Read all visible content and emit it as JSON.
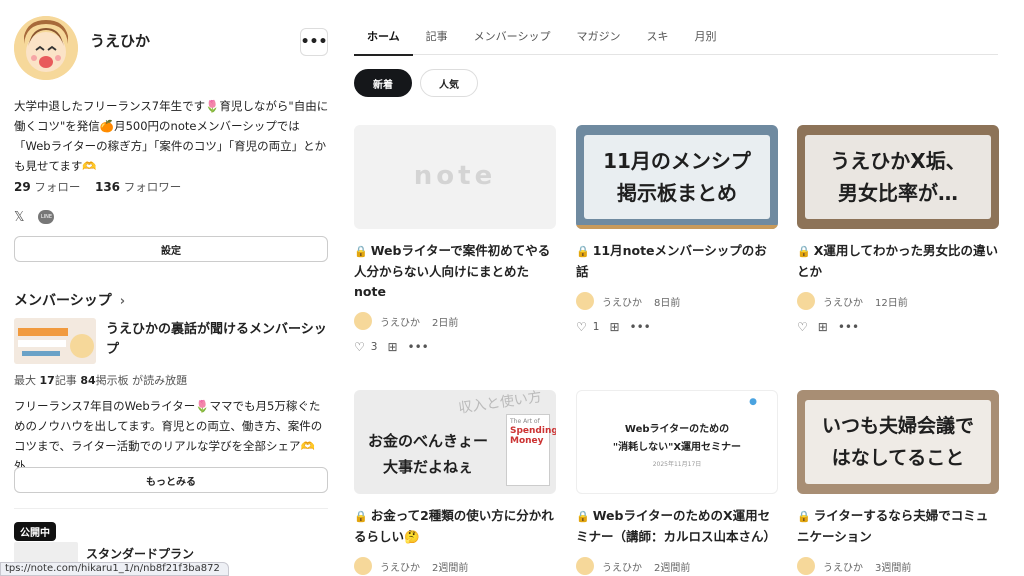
{
  "profile": {
    "name": "うえひか",
    "more_label": "•••",
    "bio": "大学中退したフリーランス7年生です🌷育児しながら\"自由に働くコツ\"を発信🍊月500円のnoteメンバーシップでは「Webライターの稼ぎ方」「案件のコツ」「育児の両立」とかも見せてます🫶",
    "following_count": "29",
    "following_label": "フォロー",
    "followers_count": "136",
    "followers_label": "フォロワー",
    "social": [
      "𝕏",
      "LINE"
    ],
    "settings_label": "設定"
  },
  "membership": {
    "section_title": "メンバーシップ",
    "chevron": "›",
    "name": "うえひかの裏話が聞けるメンバーシップ",
    "meta_prefix": "最大",
    "articles": "17",
    "articles_label": "記事",
    "boards": "84",
    "boards_label": "掲示板 が読み放題",
    "description": "フリーランス7年目のWebライター🌷ママでも月5万稼ぐためのノウハウを出してます。育児との両立、働き方、案件のコツまで、ライター活動でのリアルな学びを全部シェア🫶外...",
    "more_label": "もっとみる",
    "public_badge": "公開中",
    "plan_name": "スタンダードプラン"
  },
  "status_url": "tps://note.com/hikaru1_1/n/nb8f21f3ba872",
  "tabs": [
    "ホーム",
    "記事",
    "メンバーシップ",
    "マガジン",
    "スキ",
    "月別"
  ],
  "chips": [
    "新着",
    "人気"
  ],
  "cards": [
    {
      "thumb_text": "note",
      "title": "Webライターで案件初めてやる人分からない人向けにまとめたnote",
      "author": "うえひか",
      "when": "2日前",
      "likes": "3"
    },
    {
      "thumb_text": "11月のメンシプ\n掲示板まとめ",
      "title": "11月noteメンバーシップのお話",
      "author": "うえひか",
      "when": "8日前",
      "likes": "1"
    },
    {
      "thumb_text": "うえひかX垢、\n男女比率が…",
      "title": "X運用してわかった男女比の違いとか",
      "author": "うえひか",
      "when": "12日前",
      "likes": ""
    },
    {
      "thumb_text": "お金のべんきょー\n大事だよねぇ",
      "title": "お金って2種類の使い方に分かれるらしい🤔",
      "author": "うえひか",
      "when": "2週間前",
      "likes": ""
    },
    {
      "thumb_text": "Webライターのための\n\"消耗しない\"X運用セミナー",
      "title": "WebライターのためのX運用セミナー（講師：カルロス山本さん）",
      "author": "うえひか",
      "when": "2週間前",
      "likes": ""
    },
    {
      "thumb_text": "いつも夫婦会議で\nはなしてること",
      "title": "ライターするなら夫婦でコミュニケーション",
      "author": "うえひか",
      "when": "3週間前",
      "likes": ""
    }
  ],
  "thumb_small_text": {
    "book_title": "Spending Money",
    "book_kicker": "The Art of",
    "strip_text": "収入と使い方",
    "seminar_date": "2025年11月17日"
  },
  "colors": {
    "accent": "#15171a",
    "thumb_wood": "#c89a5b",
    "avatar": "#f6d89a"
  }
}
